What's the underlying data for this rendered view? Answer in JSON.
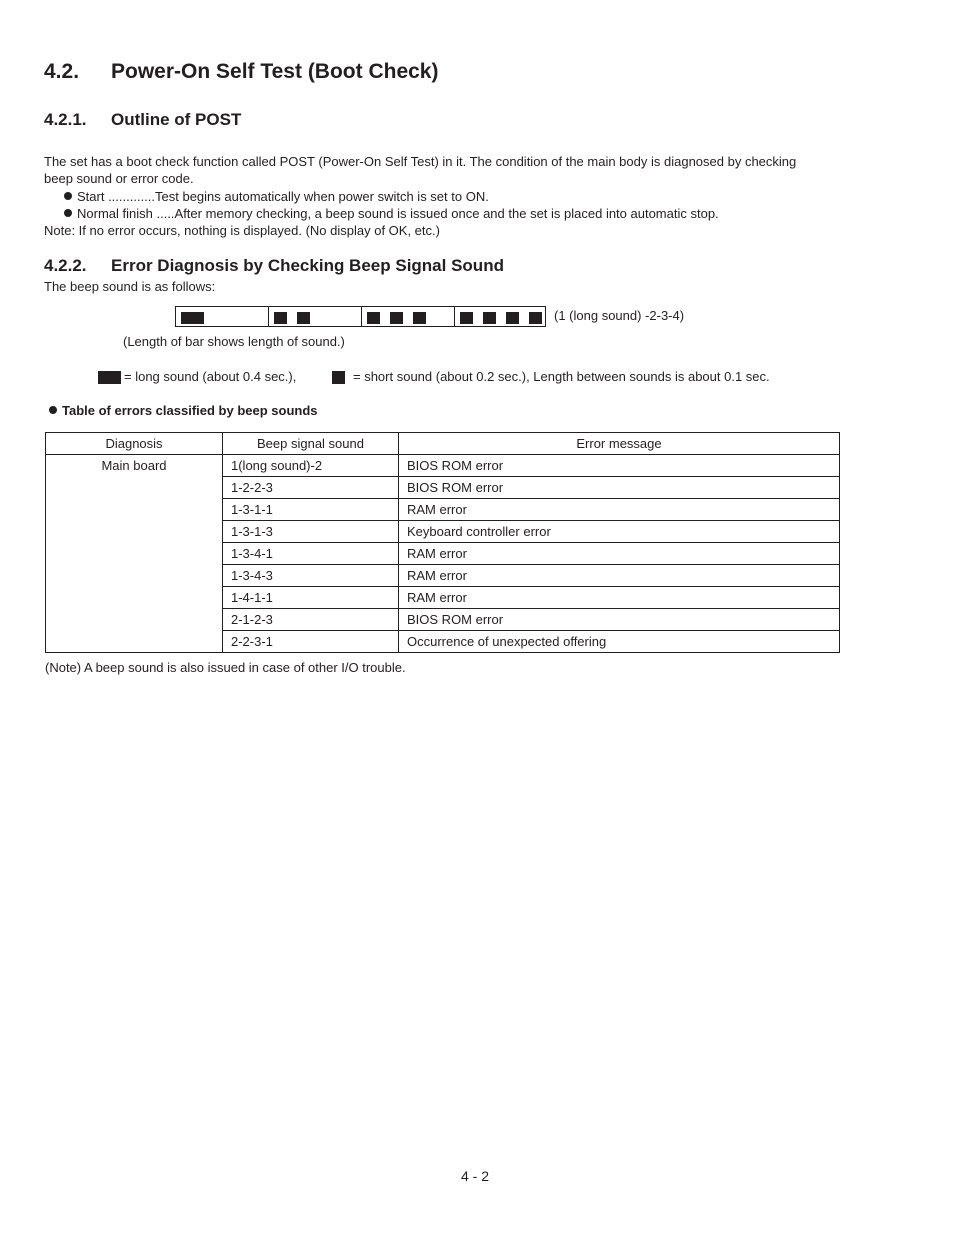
{
  "section": {
    "number": "4.2.",
    "title": "Power-On Self Test (Boot Check)"
  },
  "outline": {
    "number": "4.2.1.",
    "title": "Outline of POST",
    "intro_line1": "The set has a boot check function called POST (Power-On Self Test) in it. The condition of the main body is diagnosed by checking",
    "intro_line2": "beep sound or error code.",
    "bullets": [
      "Start .............Test begins automatically when power switch is set to ON.",
      "Normal finish .....After memory checking, a beep sound is issued once and the set is placed into automatic stop."
    ],
    "note": "Note: If no error occurs, nothing is displayed.  (No display of OK, etc.)"
  },
  "diagnosis": {
    "number": "4.2.2.",
    "title": "Error Diagnosis by Checking Beep Signal Sound",
    "intro": "The beep sound is as follows:",
    "beep_pattern": {
      "groups": [
        {
          "long": 1,
          "short": 0
        },
        {
          "long": 0,
          "short": 2
        },
        {
          "long": 0,
          "short": 3
        },
        {
          "long": 0,
          "short": 4
        }
      ],
      "label": "(1 (long sound) -2-3-4)",
      "caption": "(Length of bar shows length of sound.)"
    },
    "legend": {
      "long": "= long sound (about 0.4 sec.),",
      "short": "= short sound (about 0.2 sec.), Length between sounds is about 0.1 sec."
    },
    "table_heading": "Table of errors classified by beep sounds",
    "table": {
      "headers": [
        "Diagnosis",
        "Beep signal sound",
        "Error message"
      ],
      "diagnosis": "Main board",
      "rows": [
        {
          "beep": "1(long sound)-2",
          "message": "BIOS ROM error"
        },
        {
          "beep": "1-2-2-3",
          "message": "BIOS ROM error"
        },
        {
          "beep": "1-3-1-1",
          "message": "RAM error"
        },
        {
          "beep": "1-3-1-3",
          "message": "Keyboard controller error"
        },
        {
          "beep": "1-3-4-1",
          "message": "RAM error"
        },
        {
          "beep": "1-3-4-3",
          "message": "RAM error"
        },
        {
          "beep": "1-4-1-1",
          "message": "RAM error"
        },
        {
          "beep": "2-1-2-3",
          "message": "BIOS ROM error"
        },
        {
          "beep": "2-2-3-1",
          "message": "Occurrence of unexpected offering"
        }
      ]
    },
    "table_note": "(Note)  A beep sound is also issued in case of other I/O trouble."
  },
  "footer": {
    "page_number": "4 - 2"
  }
}
